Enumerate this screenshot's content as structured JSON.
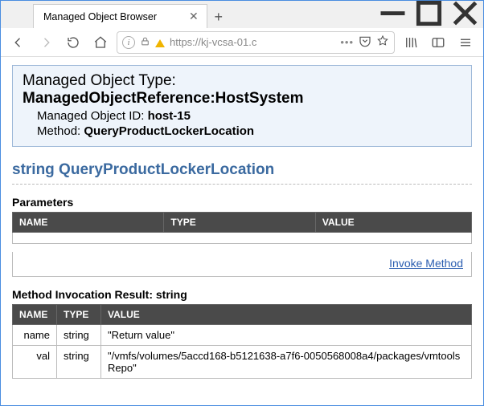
{
  "window": {
    "tab_title": "Managed Object Browser",
    "url_display": "https://kj-vcsa-01.c"
  },
  "mo_box": {
    "type_label": "Managed Object Type:",
    "ref_type": "ManagedObjectReference:HostSystem",
    "id_label": "Managed Object ID:",
    "id_value": "host-15",
    "method_label": "Method:",
    "method_value": "QueryProductLockerLocation"
  },
  "method_sig": "string QueryProductLockerLocation",
  "params": {
    "heading": "Parameters",
    "cols": {
      "name": "NAME",
      "type": "TYPE",
      "value": "VALUE"
    }
  },
  "invoke_label": "Invoke Method",
  "result": {
    "heading": "Method Invocation Result: string",
    "cols": {
      "name": "NAME",
      "type": "TYPE",
      "value": "VALUE"
    },
    "rows": [
      {
        "name": "name",
        "type": "string",
        "value": "\"Return value\""
      },
      {
        "name": "val",
        "type": "string",
        "value": "\"/vmfs/volumes/5accd168-b5121638-a7f6-0050568008a4/packages/vmtoolsRepo\""
      }
    ]
  }
}
